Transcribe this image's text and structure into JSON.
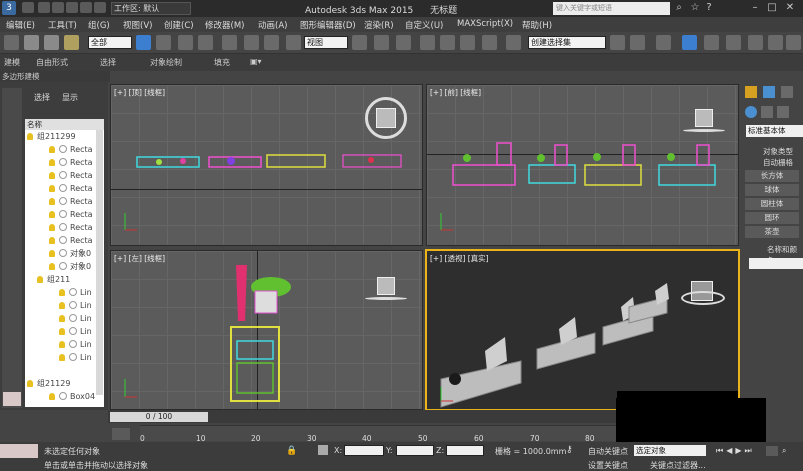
{
  "titlebar": {
    "workspace_label": "工作区: 默认",
    "app_title": "Autodesk 3ds Max  2015",
    "file_name": "无标题",
    "search_placeholder": "键入关键字或短语"
  },
  "menu": [
    "编辑(E)",
    "工具(T)",
    "组(G)",
    "视图(V)",
    "创建(C)",
    "修改器(M)",
    "动画(A)",
    "图形编辑器(D)",
    "渲染(R)",
    "自定义(U)",
    "MAXScript(X)",
    "帮助(H)"
  ],
  "toolbar": {
    "selection_filter": "全部",
    "reference_coord": "视图",
    "named_selection": "创建选择集"
  },
  "ribbon": {
    "tabs": [
      "建模",
      "自由形式",
      "选择",
      "对象绘制",
      "填充"
    ],
    "sub_label": "多边形建模"
  },
  "explorer": {
    "tabs": [
      "选择",
      "显示"
    ],
    "column_header": "名称",
    "rows": [
      "组211299",
      "Recta",
      "Recta",
      "Recta",
      "Recta",
      "Recta",
      "Recta",
      "Recta",
      "Recta",
      "对象0",
      "对象0",
      "组211",
      "Lin",
      "Lin",
      "Lin",
      "Lin",
      "Lin",
      "Lin",
      "组21129",
      "Box04"
    ]
  },
  "viewports": {
    "top": "[+] [顶] [线框]",
    "front": "[+] [前] [线框]",
    "left": "[+] [左] [线框]",
    "persp": "[+] [透视] [真实]"
  },
  "command_panel": {
    "dropdown": "标准基本体",
    "rollout": "对象类型",
    "autogrid": "自动栅格",
    "buttons": [
      "长方体",
      "球体",
      "圆柱体",
      "圆环",
      "茶壶"
    ],
    "name_rollout": "名称和颜色"
  },
  "timeline": {
    "slider": "0 / 100",
    "ticks": [
      "0",
      "10",
      "20",
      "30",
      "40",
      "50",
      "60",
      "70",
      "80"
    ]
  },
  "statusbar": {
    "selection_status": "未选定任何对象",
    "prompt": "单击或单击并拖动以选择对象",
    "x_label": "X:",
    "y_label": "Y:",
    "z_label": "Z:",
    "grid": "栅格 = 1000.0mm",
    "autokey": "自动关键点",
    "set_key_filter": "选定对象",
    "set_key": "设置关键点",
    "key_filters": "关键点过滤器..."
  },
  "colors": {
    "active_viewport": "#e9b31a",
    "viewport_bg": "#5b5b5b",
    "ui_bg": "#444444"
  }
}
